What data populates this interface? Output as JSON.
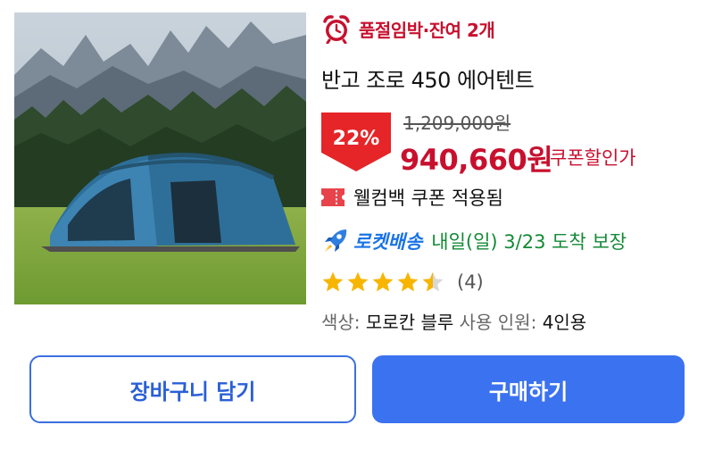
{
  "stock_alert": {
    "text": "품절임박·잔여 2개",
    "icon": "alarm-clock-icon",
    "color": "#c8102e"
  },
  "product": {
    "name": "반고 조로 450 에어텐트"
  },
  "price": {
    "discount": "22%",
    "original": "1,209,000원",
    "sale": "940,660원",
    "coupon_note": "쿠폰할인가",
    "accent": "#e52528"
  },
  "welcome_coupon": {
    "text": "웰컴백 쿠폰 적용됨",
    "icon": "coupon-icon"
  },
  "delivery": {
    "badge": "로켓배송",
    "text": "내일(일) 3/23 도착 보장",
    "icon": "rocket-icon",
    "badge_color": "#1a73e8",
    "text_color": "#138a36"
  },
  "rating": {
    "stars": 4.5,
    "max": 5,
    "count": "(4)"
  },
  "options": {
    "color_label": "색상:",
    "color_value": "모로칸 블루",
    "people_label": "사용 인원:",
    "people_value": "4인용"
  },
  "buttons": {
    "cart": "장바구니 담기",
    "buy": "구매하기",
    "buy_color": "#3b72f0"
  }
}
